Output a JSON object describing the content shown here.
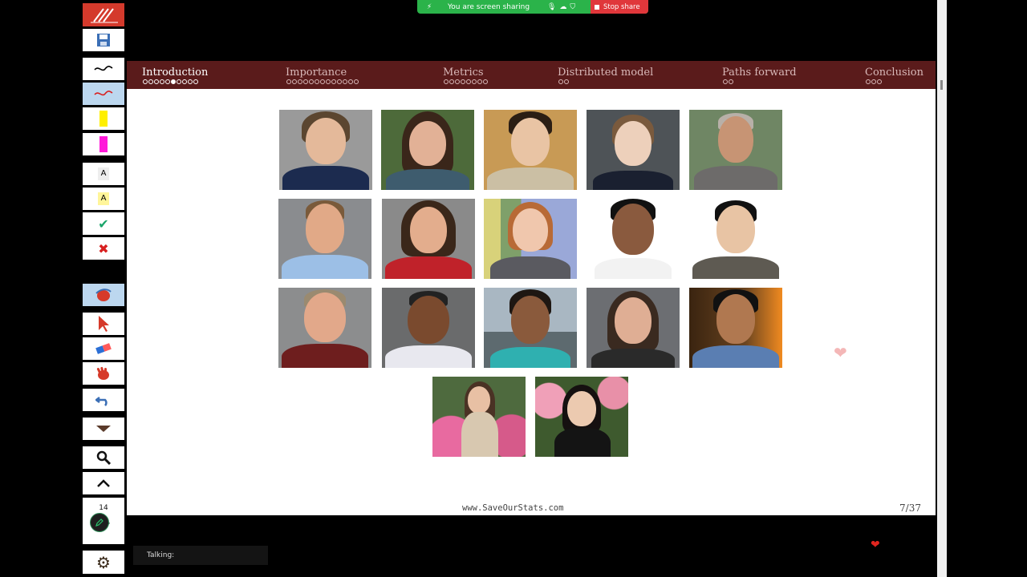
{
  "share_bar": {
    "status_text": "You are screen sharing",
    "stop_label": "Stop share"
  },
  "toolbar": {
    "page_badge": "14"
  },
  "slide": {
    "sections": [
      {
        "label": "Introduction",
        "dots": 10,
        "filled": 6,
        "current": true
      },
      {
        "label": "Importance",
        "dots": 13,
        "filled": 0,
        "current": false
      },
      {
        "label": "Metrics",
        "dots": 8,
        "filled": 0,
        "current": false
      },
      {
        "label": "Distributed model",
        "dots": 2,
        "filled": 0,
        "current": false
      },
      {
        "label": "Paths forward",
        "dots": 2,
        "filled": 0,
        "current": false
      },
      {
        "label": "Conclusion",
        "dots": 3,
        "filled": 0,
        "current": false
      }
    ],
    "footer_url": "www.SaveOurStats.com",
    "page_number": "7/37"
  },
  "status": {
    "talking_label": "Talking:"
  },
  "colors": {
    "nav_bg": "#5a1b1b",
    "share_green": "#2bb34a",
    "stop_red": "#e0373b"
  }
}
